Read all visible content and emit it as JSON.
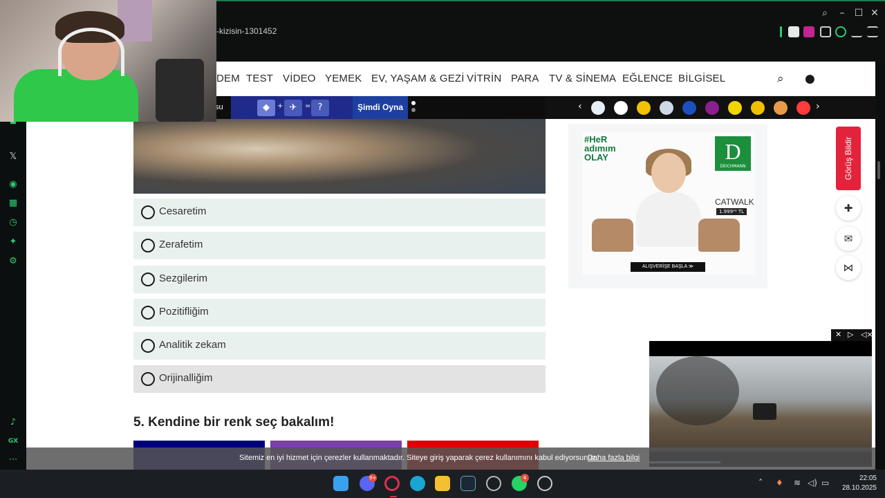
{
  "browser": {
    "url_fragment": "-kizisin-1301452",
    "window_controls": [
      "search-icon",
      "minimize-icon",
      "maximize-icon",
      "close-icon"
    ],
    "extensions": [
      "wallet-icon",
      "puzzle-pink-icon",
      "extensions-icon",
      "profile-icon",
      "download-icon",
      "menu-icon"
    ]
  },
  "sidebar": {
    "icons": [
      "whatsapp-icon",
      "messenger-icon",
      "x-icon",
      "player-icon",
      "apps-icon",
      "history-icon",
      "extensions-icon",
      "settings-icon",
      "tiktok-icon",
      "gx-icon",
      "more-icon"
    ]
  },
  "nav": {
    "items": [
      "DEM",
      "TEST",
      "VİDEO",
      "YEMEK",
      "EV, YAŞAM & GEZİ",
      "VİTRİN",
      "PARA",
      "TV & SİNEMA",
      "EĞLENCE",
      "BİLGİSEL"
    ]
  },
  "strip": {
    "left_text": "su",
    "puzzle_symbols": [
      "+",
      "=",
      "?"
    ],
    "play_label": "Şimdi Oyna"
  },
  "quiz": {
    "options": [
      "Cesaretim",
      "Zerafetim",
      "Sezgilerim",
      "Pozitifliğim",
      "Analitik zekam",
      "Orijinalliğim"
    ],
    "next_question": "5. Kendine bir renk seç bakalım!"
  },
  "ad": {
    "hashtag": "#HeR adımım OLAY",
    "brand": "D",
    "brand_sub": "DEICHMANN",
    "collection": "CATWALK",
    "price": "1.999⁹⁹ TL",
    "cta": "ALIŞVERİŞE BAŞLA ≫"
  },
  "side_actions": {
    "feedback_label": "Görüş Bildir"
  },
  "cookie": {
    "text": "Sitemiz en iyi hizmet için çerezler kullanmaktadır. Siteye giriş yaparak çerez kullanımını kabul ediyorsunuz.",
    "link": "Daha fazla bilgi"
  },
  "taskbar": {
    "discord_badge": "9+",
    "whatsapp_badge": "4",
    "time": "22:05",
    "date": "28.10.2025"
  },
  "colors": {
    "accent_green": "#2ecc71",
    "option_bg": "#e9f1ee",
    "feedback_red": "#e2233b",
    "color_choices": [
      "#00007a",
      "#7a3fa8",
      "#e00000"
    ]
  }
}
